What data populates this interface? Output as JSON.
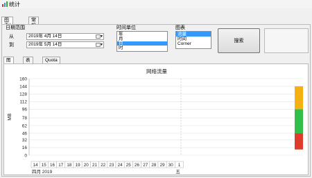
{
  "window": {
    "title": "统计"
  },
  "outer_tabs": [
    "图表/表格",
    "常规"
  ],
  "date_range": {
    "label": "日期范围",
    "from_label": "从",
    "from_value": "2019年 4月 14日",
    "to_label": "到",
    "to_value": "2019年 5月 14日"
  },
  "time_unit": {
    "label": "时间单位",
    "options": [
      "年",
      "月",
      "日",
      "时"
    ],
    "selected": 2
  },
  "chart_kind": {
    "label": "图表",
    "options": [
      "流量",
      "时间",
      "Corner"
    ],
    "selected": 0
  },
  "search_label": "搜索",
  "inner_tabs": [
    "图表",
    "表格",
    "Quota"
  ],
  "colors": {
    "selection": "#3399ff",
    "bar_yellow": "#f5b013",
    "bar_green": "#30c04a",
    "bar_red": "#e03a2a",
    "grid": "#d8d8d8"
  },
  "chart_data": {
    "type": "bar",
    "title": "网络流量",
    "ylabel": "MB",
    "ylim": [
      0,
      160
    ],
    "yticks": [
      0,
      16,
      32,
      46,
      62,
      78,
      96,
      112,
      128,
      144,
      160
    ],
    "x": [
      "14",
      "15",
      "16",
      "17",
      "18",
      "19",
      "20",
      "21",
      "22",
      "23",
      "24",
      "25",
      "26",
      "27",
      "28",
      "29",
      "30",
      "1"
    ],
    "month_labels": [
      "四月 2019",
      "五"
    ],
    "values": [
      0,
      0,
      0,
      0,
      0,
      0,
      0,
      0,
      0,
      0,
      0,
      0,
      0,
      0,
      0,
      0,
      0,
      0
    ],
    "legend_segments": [
      {
        "color": "#f5b013",
        "from": 96,
        "to": 144
      },
      {
        "color": "#30c04a",
        "from": 46,
        "to": 96
      },
      {
        "color": "#e03a2a",
        "from": 12,
        "to": 46
      }
    ]
  }
}
